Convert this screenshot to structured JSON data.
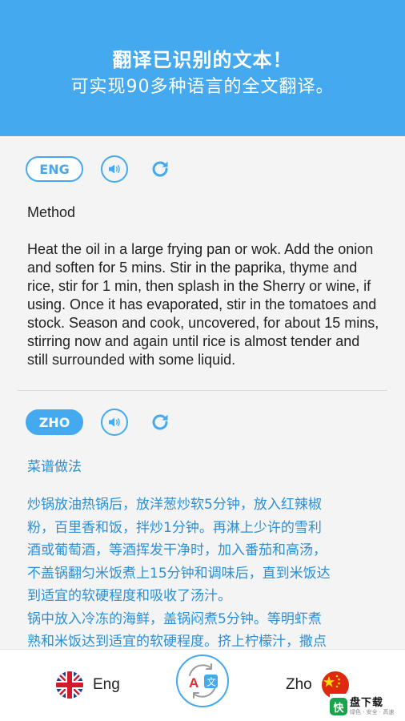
{
  "header": {
    "line1": "翻译已识别的文本！",
    "line2": "可实现90多种语言的全文翻译。"
  },
  "source_panel": {
    "lang_code": "ENG",
    "speaker_icon": "speaker-icon",
    "refresh_icon": "refresh-icon",
    "heading": "Method",
    "body": "Heat the oil in a large frying pan or wok. Add the onion and soften for 5 mins. Stir in the paprika, thyme and rice, stir for 1 min, then splash in the Sherry or wine, if using. Once it has evaporated, stir in the tomatoes and stock. Season and cook, uncovered, for about 15 mins, stirring now and again until rice is almost tender and still surrounded with some liquid."
  },
  "target_panel": {
    "lang_code": "ZHO",
    "speaker_icon": "speaker-icon",
    "refresh_icon": "refresh-icon",
    "heading": "菜谱做法",
    "body_lines": [
      "炒锅放油热锅后，放洋葱炒软5分钟，放入红辣椒",
      "粉，百里香和饭，拌炒1分钟。再淋上少许的雪利",
      "酒或葡萄酒，等酒挥发干净时，加入番茄和高汤，",
      "不盖锅翻匀米饭煮上15分钟和调味后，直到米饭达",
      "到适宜的软硬程度和吸收了汤汁。",
      "锅中放入冷冻的海鲜，盖锅闷煮5分钟。等明虾煮",
      "熟和米饭达到适宜的软硬程度。挤上柠檬汁，撒点"
    ]
  },
  "bottom_bar": {
    "source_label": "Eng",
    "target_label": "Zho",
    "source_flag": "uk-flag-icon",
    "target_flag": "china-flag-icon",
    "swap_icon": "translate-swap-icon"
  },
  "watermark": {
    "badge": "快",
    "name": "盘下载",
    "sub": "绿色 · 安全 · 高速"
  },
  "colors": {
    "accent": "#44a9ee",
    "translated_text": "#2b8fd6"
  }
}
